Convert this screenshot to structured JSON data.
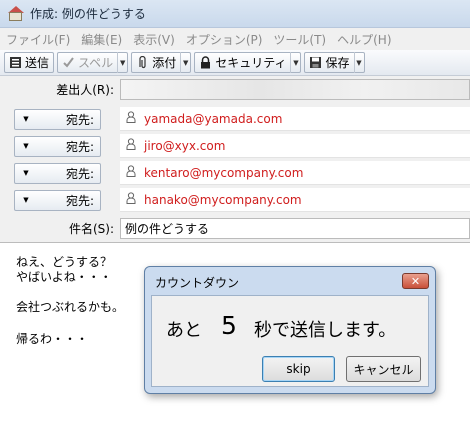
{
  "window": {
    "title": "作成: 例の件どうする"
  },
  "menu": [
    "ファイル(F)",
    "編集(E)",
    "表示(V)",
    "オプション(P)",
    "ツール(T)",
    "ヘルプ(H)"
  ],
  "toolbar": {
    "send_label": "送信",
    "spell_label": "スペル",
    "attach_label": "添付",
    "security_label": "セキュリティ",
    "save_label": "保存"
  },
  "header": {
    "from_label": "差出人(R):",
    "to_label": "宛先:",
    "subject_label": "件名(S):",
    "subject_value": "例の件どうする",
    "recipients": [
      "yamada@yamada.com",
      "jiro@xyx.com",
      "kentaro@mycompany.com",
      "hanako@mycompany.com"
    ]
  },
  "body": {
    "lines": [
      "ねえ、どうする？",
      "やばいよね・・・",
      "",
      "会社つぶれるかも。",
      "",
      "帰るわ・・・"
    ]
  },
  "dialog": {
    "title": "カウントダウン",
    "message_pre": "あと",
    "countdown": "5",
    "message_post": "秒で送信します。",
    "skip_label": "skip",
    "cancel_label": "キャンセル"
  },
  "colors": {
    "recipient_text": "#d01d1d",
    "titlebar": "#c9d9ec",
    "dialog_frame": "#cbdbef"
  }
}
